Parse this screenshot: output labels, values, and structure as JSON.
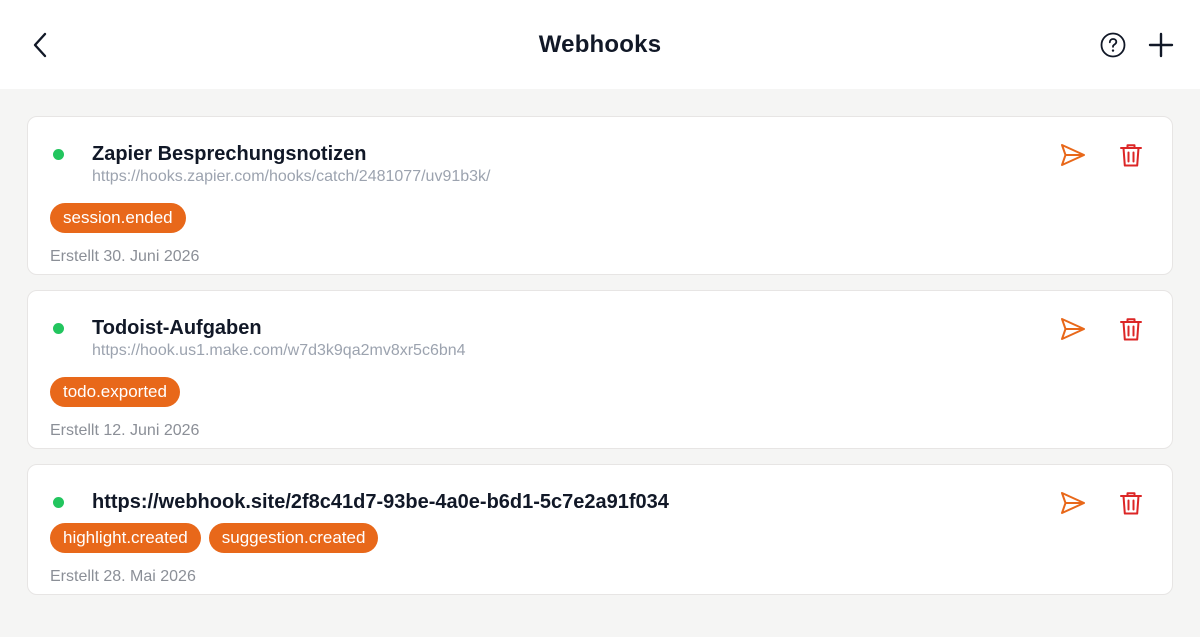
{
  "header": {
    "title": "Webhooks",
    "back_icon": "chevron-left-icon",
    "help_icon": "help-circle-icon",
    "add_icon": "plus-icon"
  },
  "colors": {
    "accent": "#e8681a",
    "active": "#22c55e",
    "delete": "#dc2626",
    "background": "#f5f5f4"
  },
  "webhooks": [
    {
      "name": "Zapier Besprechungsnotizen",
      "url": "https://hooks.zapier.com/hooks/catch/2481077/uv91b3k/",
      "events": [
        "session.ended"
      ],
      "created": "Erstellt 30. Juni 2026",
      "status": "active"
    },
    {
      "name": "Todoist-Aufgaben",
      "url": "https://hook.us1.make.com/w7d3k9qa2mv8xr5c6bn4",
      "events": [
        "todo.exported"
      ],
      "created": "Erstellt 12. Juni 2026",
      "status": "active"
    },
    {
      "name": "https://webhook.site/2f8c41d7-93be-4a0e-b6d1-5c7e2a91f034",
      "url": "",
      "events": [
        "highlight.created",
        "suggestion.created"
      ],
      "created": "Erstellt 28. Mai 2026",
      "status": "active"
    }
  ]
}
